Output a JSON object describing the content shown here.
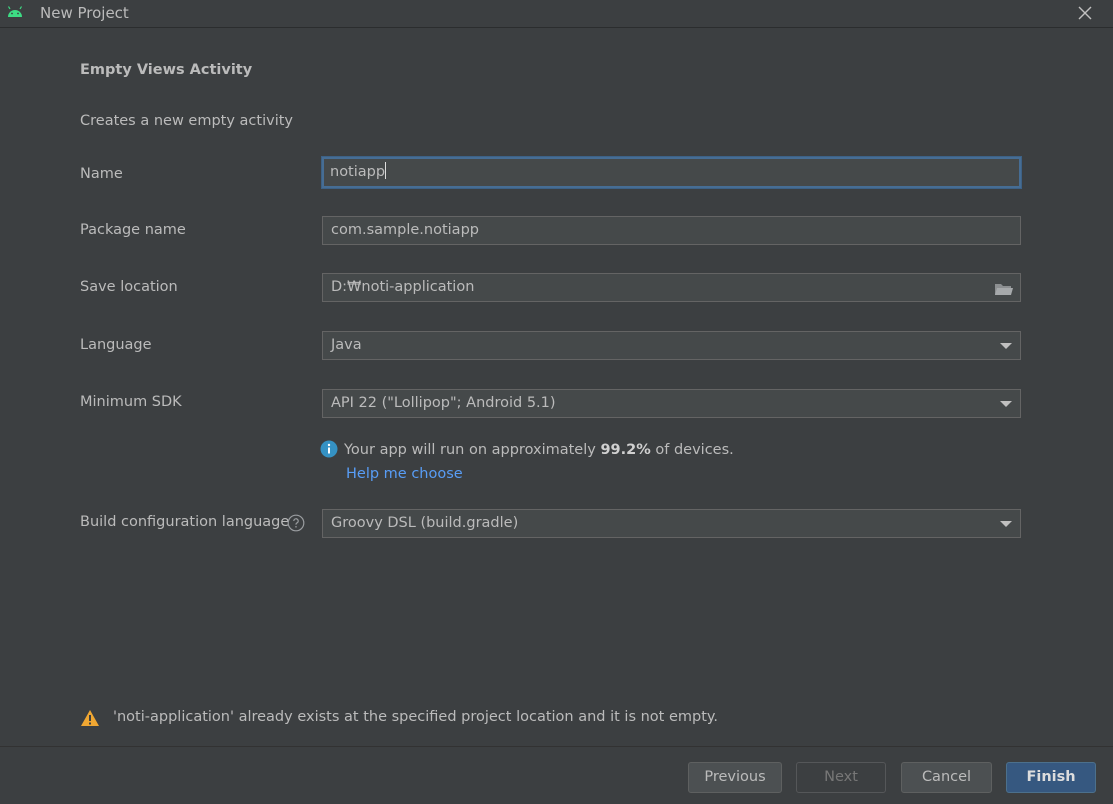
{
  "window": {
    "title": "New Project",
    "app_icon": "android-icon",
    "close_icon": "close-icon"
  },
  "template": {
    "heading": "Empty Views Activity",
    "description": "Creates a new empty activity"
  },
  "form": {
    "name": {
      "label": "Name",
      "value": "notiapp"
    },
    "package_name": {
      "label": "Package name",
      "value": "com.sample.notiapp"
    },
    "save_location": {
      "label": "Save location",
      "value": "D:₩noti-application",
      "icon": "folder-icon"
    },
    "language": {
      "label": "Language",
      "value": "Java"
    },
    "minimum_sdk": {
      "label": "Minimum SDK",
      "value": "API 22 (\"Lollipop\"; Android 5.1)"
    },
    "sdk_info": {
      "prefix": "Your app will run on approximately ",
      "percent": "99.2%",
      "suffix": " of devices.",
      "icon": "info-icon",
      "help_link": "Help me choose"
    },
    "build_config": {
      "label": "Build configuration language",
      "value": "Groovy DSL (build.gradle)",
      "icon": "help-circle-icon"
    }
  },
  "warning": {
    "icon": "warning-icon",
    "text": "'noti-application' already exists at the specified project location and it is not empty."
  },
  "buttons": {
    "previous": "Previous",
    "next": "Next",
    "cancel": "Cancel",
    "finish": "Finish"
  },
  "colors": {
    "background": "#3c3f41",
    "field_background": "#45494a",
    "focus_border": "#466d94",
    "link": "#589df6",
    "info": "#3592c4",
    "warning": "#f0a732",
    "primary_button": "#365880",
    "android_green": "#3ddc84"
  }
}
